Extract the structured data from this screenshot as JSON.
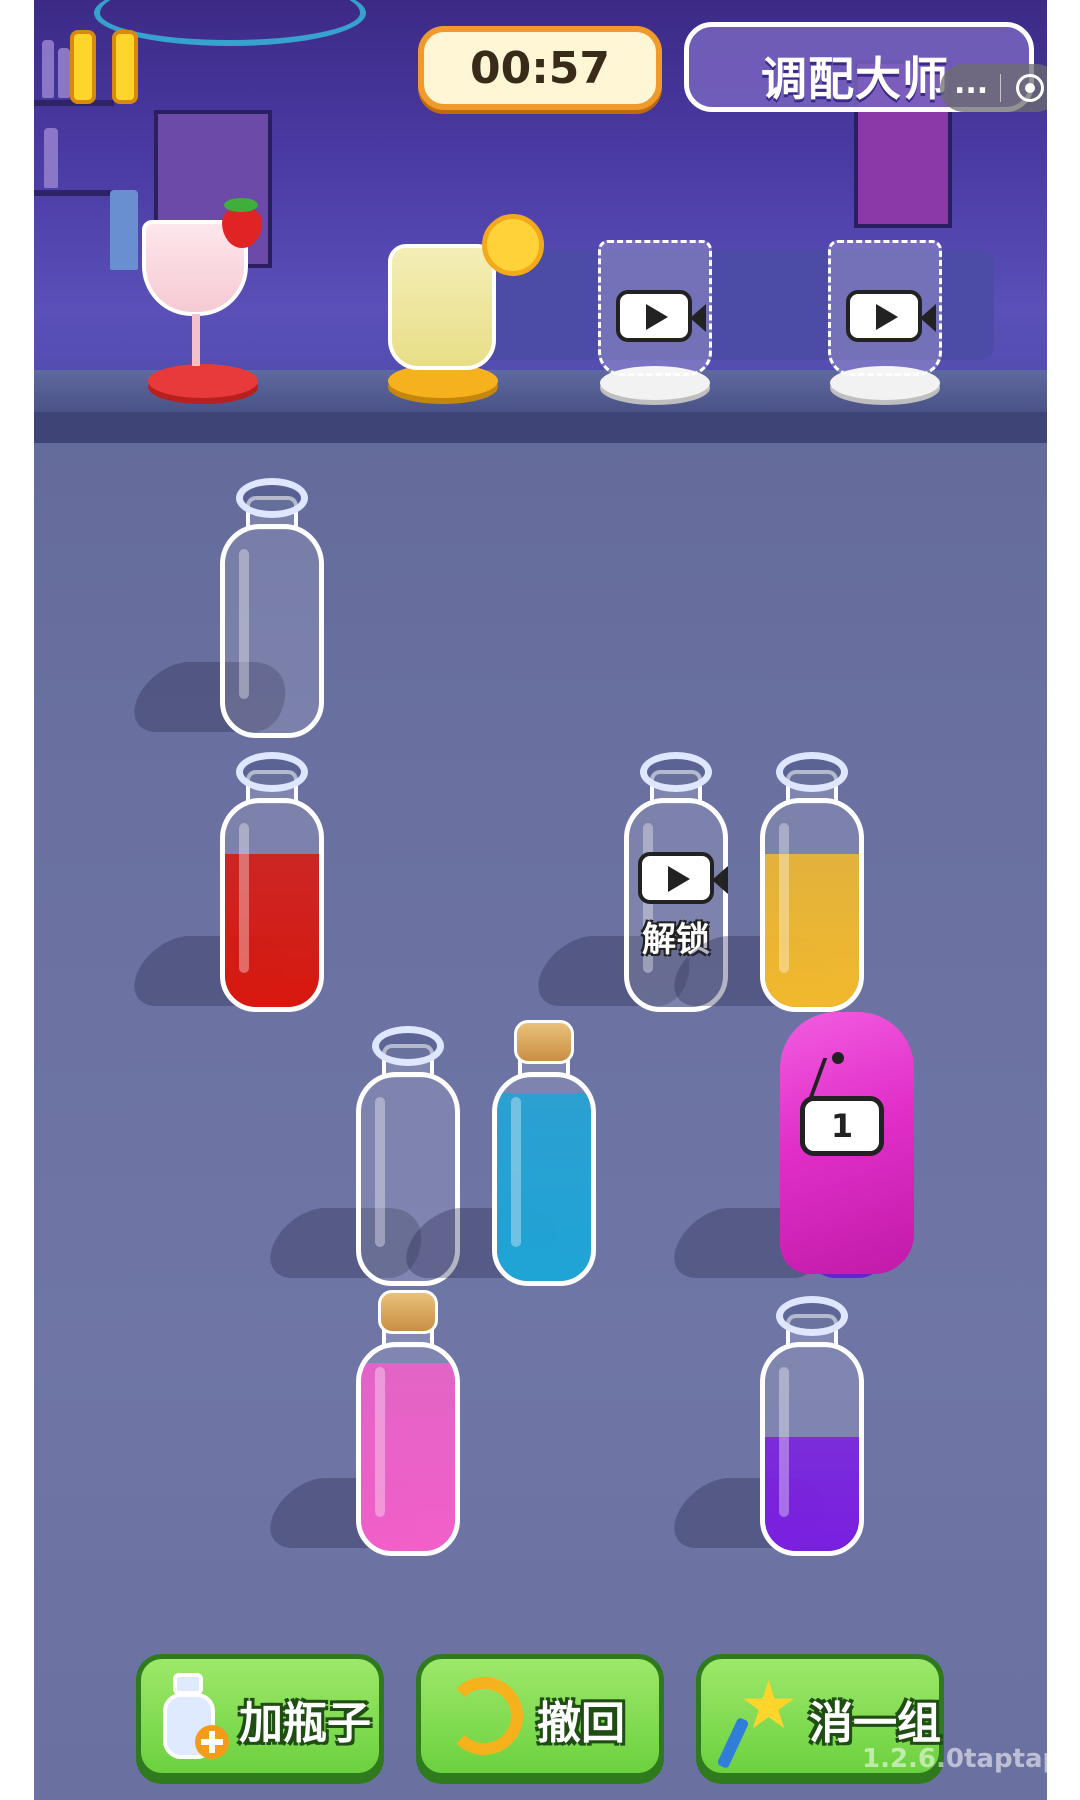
{
  "header": {
    "timer": "00:57",
    "title": "调配大师",
    "capsule_more": "..."
  },
  "orders": [
    {
      "name": "strawberry-cocktail",
      "color": "#f6c9d2",
      "coaster": "#e83a3a",
      "garnish": "strawberry"
    },
    {
      "name": "lemonade",
      "color": "#f1eaa5",
      "coaster": "#f6b21c",
      "garnish": "lemon-slice"
    },
    {
      "name": "locked-cup-1",
      "state": "locked",
      "icon": "video-icon"
    },
    {
      "name": "locked-cup-2",
      "state": "locked",
      "icon": "video-icon"
    }
  ],
  "bottles": {
    "empty_top": {
      "fill": 0,
      "color": ""
    },
    "red": {
      "fill": 0.75,
      "color": "#d8180f"
    },
    "locked": {
      "fill": 0,
      "unlock_label": "解锁"
    },
    "yellow": {
      "fill": 0.75,
      "color": "#f2b92c"
    },
    "empty_mid": {
      "fill": 0,
      "color": ""
    },
    "blue": {
      "fill": 0.92,
      "color": "#1fa4d6",
      "corked": true
    },
    "covered": {
      "sign_number": "1",
      "cover_color": "#e12fc9"
    },
    "pink": {
      "fill": 0.92,
      "color": "#f25fc9",
      "corked": true
    },
    "purple": {
      "fill": 0.56,
      "color": "#7a1fe0"
    }
  },
  "actions": {
    "add_bottle": "加瓶子",
    "undo": "撤回",
    "remove_group": "消一组"
  },
  "footer": {
    "version": "1.2.6.0taptap"
  }
}
